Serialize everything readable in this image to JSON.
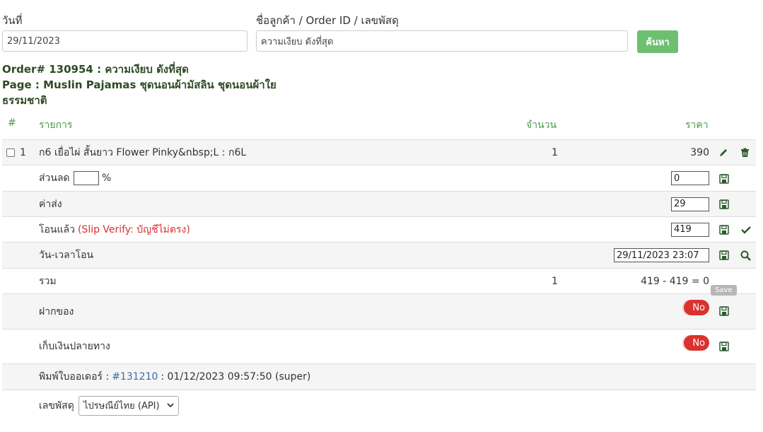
{
  "search": {
    "date_label": "วันที่",
    "date_value": "29/11/2023",
    "customer_label": "ชื่อลูกค้า / Order ID / เลขพัสดุ",
    "customer_value": "ความเงียบ ดังที่สุด",
    "search_button": "ค้นหา"
  },
  "order": {
    "title": "Order# 130954 : ความเงียบ ดังที่สุด",
    "page_line": "Page : Muslin Pajamas ชุดนอนผ้ามัสลิน ชุดนอนผ้าใย",
    "page_line2": "ธรรมชาติ"
  },
  "table": {
    "headers": {
      "num": "#",
      "item": "รายการ",
      "qty": "จำนวน",
      "price": "ราคา"
    },
    "item_row": {
      "num": "1",
      "name": "ก6 เยื่อไผ่ สั้นยาว Flower Pinky&nbsp;L : ก6L",
      "qty": "1",
      "price": "390"
    },
    "discount": {
      "label": "ส่วนลด",
      "percent_value": "",
      "percent_sign": "%",
      "value": "0"
    },
    "shipping": {
      "label": "ค่าส่ง",
      "value": "29"
    },
    "paid": {
      "label": "โอนแล้ว",
      "note": "(Slip Verify: บัญชีไม่ตรง)",
      "value": "419"
    },
    "transfer_time": {
      "label": "วัน-เวลาโอน",
      "value": "29/11/2023 23:07"
    },
    "total": {
      "label": "รวม",
      "qty": "1",
      "value": "419 - 419 = 0"
    },
    "deposit": {
      "label": "ฝากของ",
      "toggle": "No",
      "tooltip": "Save"
    },
    "cod": {
      "label": "เก็บเงินปลายทาง",
      "toggle": "No"
    },
    "print": {
      "prefix": "พิมพ์ใบออเดอร์ :",
      "link": "#131210",
      "suffix": ": 01/12/2023 09:57:50 (super)"
    },
    "tracking": {
      "label": "เลขพัสดุ",
      "selected": "ไปรษณีย์ไทย (API)"
    }
  },
  "colors": {
    "accent_green": "#6cc070",
    "header_green": "#4a9a4a",
    "toggle_red": "#d9322f",
    "link_blue": "#3a6ea5"
  }
}
